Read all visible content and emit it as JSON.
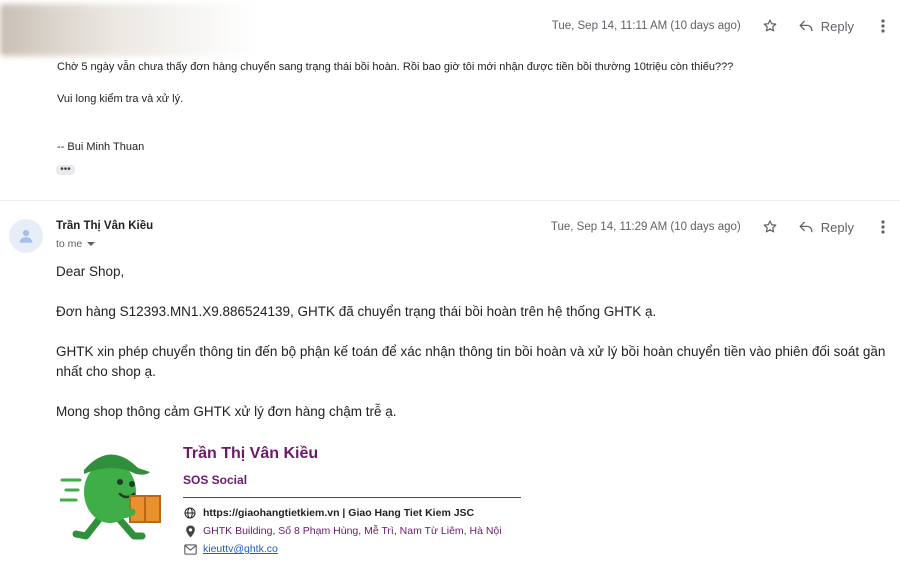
{
  "message1": {
    "timestamp": "Tue, Sep 14, 11:11 AM (10 days ago)",
    "reply_label": "Reply",
    "lines": [
      "Chờ 5 ngày vẫn chưa thấy đơn hàng chuyển sang trạng thái bồi hoàn. Rồi bao giờ tôi mới nhận được tiền bồi thường 10triệu còn thiếu???",
      "Vui long kiểm tra và xử lý.",
      "-- Bui Minh Thuan"
    ],
    "trimmed_label": "•••"
  },
  "message2": {
    "sender": "Trần Thị Vân Kiều",
    "to": "to me",
    "timestamp": "Tue, Sep 14, 11:29 AM (10 days ago)",
    "reply_label": "Reply",
    "paragraphs": [
      "Dear Shop,",
      "Đơn hàng S12393.MN1.X9.886524139, GHTK đã chuyển trạng thái bồi hoàn trên hệ thống GHTK ạ.",
      "GHTK xin phép chuyển thông tin đến bộ phận kế toán để xác nhận thông tin bồi hoàn và xử lý bồi hoàn chuyển tiền vào phiên đối soát gần nhất cho shop ạ.",
      "Mong shop thông cảm GHTK xử lý đơn hàng chậm trễ ạ."
    ],
    "signature": {
      "name": "Trần Thị Vân Kiều",
      "title": "SOS Social",
      "website_line": "https://giaohangtietkiem.vn | Giao Hang Tiet Kiem JSC",
      "address": "GHTK Building, Số 8 Phạm Hùng, Mễ Trì, Nam Từ Liêm, Hà Nội",
      "email": "kieuttv@ghtk.co"
    }
  },
  "colors": {
    "signature_purple": "#6b1a6b",
    "mascot_green": "#3fae49",
    "box_orange": "#e8912d",
    "link_blue": "#1a5ec7"
  }
}
